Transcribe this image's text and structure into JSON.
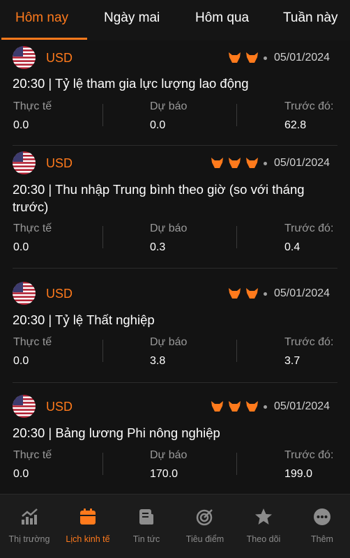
{
  "tabs": [
    {
      "label": "Hôm nay",
      "active": true
    },
    {
      "label": "Ngày mai",
      "active": false
    },
    {
      "label": "Hôm qua",
      "active": false
    },
    {
      "label": "Tuần này",
      "active": false
    }
  ],
  "labels": {
    "actual": "Thực tế",
    "forecast": "Dự báo",
    "previous": "Trước đó:"
  },
  "events": [
    {
      "currency": "USD",
      "impact": 2,
      "date": "05/01/2024",
      "title": "20:30 | Tỷ lệ tham gia lực lượng lao động",
      "actual": "0.0",
      "forecast": "0.0",
      "previous": "62.8"
    },
    {
      "currency": "USD",
      "impact": 3,
      "date": "05/01/2024",
      "title": "20:30 | Thu nhập Trung bình theo giờ (so với tháng trước)",
      "actual": "0.0",
      "forecast": "0.3",
      "previous": "0.4"
    },
    {
      "currency": "USD",
      "impact": 2,
      "date": "05/01/2024",
      "title": "20:30 | Tỷ lệ Thất nghiệp",
      "actual": "0.0",
      "forecast": "3.8",
      "previous": "3.7"
    },
    {
      "currency": "USD",
      "impact": 3,
      "date": "05/01/2024",
      "title": "20:30 | Bảng lương Phi nông nghiệp",
      "actual": "0.0",
      "forecast": "170.0",
      "previous": "199.0"
    }
  ],
  "bottom_nav": [
    {
      "label": "Thị trường",
      "icon": "chart-line-icon",
      "active": false
    },
    {
      "label": "Lịch kinh tế",
      "icon": "calendar-icon",
      "active": true
    },
    {
      "label": "Tin tức",
      "icon": "news-icon",
      "active": false
    },
    {
      "label": "Tiêu điểm",
      "icon": "target-icon",
      "active": false
    },
    {
      "label": "Theo dõi",
      "icon": "star-icon",
      "active": false
    },
    {
      "label": "Thêm",
      "icon": "more-icon",
      "active": false
    }
  ],
  "colors": {
    "accent": "#ff7a1c",
    "background": "#131313",
    "label_gray": "#9a9a9a"
  }
}
